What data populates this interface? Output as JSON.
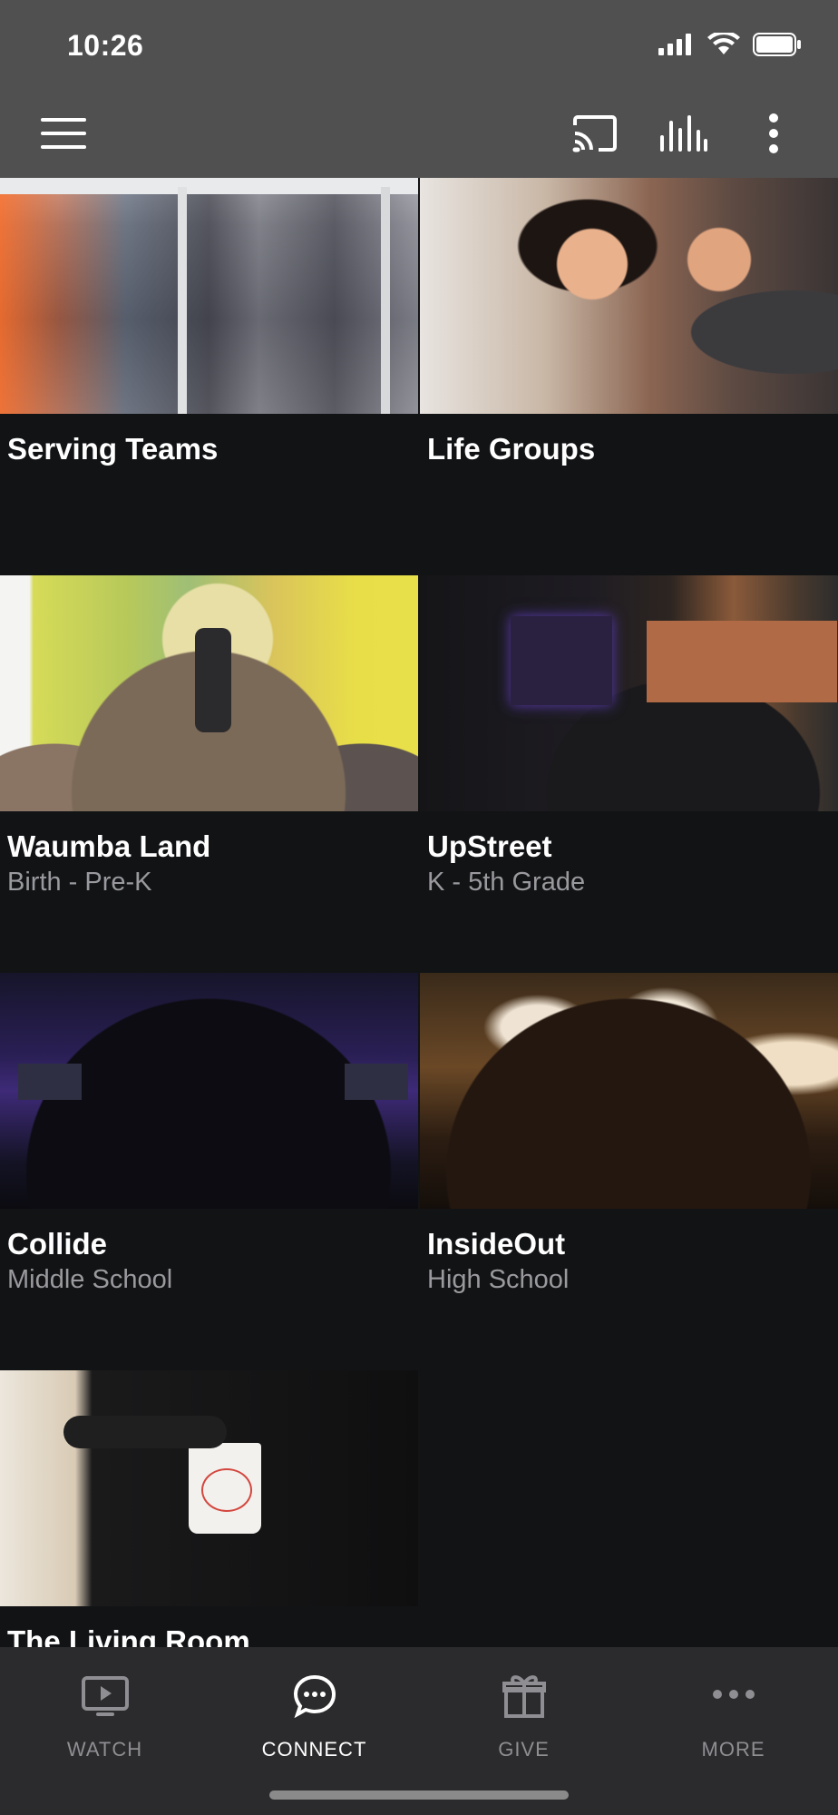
{
  "status": {
    "time": "10:26"
  },
  "app_bar": {
    "menu_icon": "hamburger-menu-icon",
    "cast_icon": "cast-icon",
    "audio_icon": "audio-bars-icon",
    "more_icon": "vertical-dots-icon"
  },
  "cards": [
    {
      "title": "Serving Teams",
      "subtitle": ""
    },
    {
      "title": "Life Groups",
      "subtitle": ""
    },
    {
      "title": "Waumba Land",
      "subtitle": "Birth - Pre-K"
    },
    {
      "title": "UpStreet",
      "subtitle": "K - 5th Grade"
    },
    {
      "title": "Collide",
      "subtitle": "Middle School"
    },
    {
      "title": "InsideOut",
      "subtitle": "High School"
    },
    {
      "title": "The Living Room",
      "subtitle": ""
    }
  ],
  "tabs": [
    {
      "label": "WATCH",
      "icon": "tv-play-icon"
    },
    {
      "label": "CONNECT",
      "icon": "chat-bubble-icon"
    },
    {
      "label": "GIVE",
      "icon": "gift-icon"
    },
    {
      "label": "MORE",
      "icon": "horizontal-dots-icon"
    }
  ],
  "colors": {
    "header": "#505050",
    "background": "#121315",
    "tab_bar": "#2b2b2d",
    "inactive_tab": "#8e8e93"
  }
}
